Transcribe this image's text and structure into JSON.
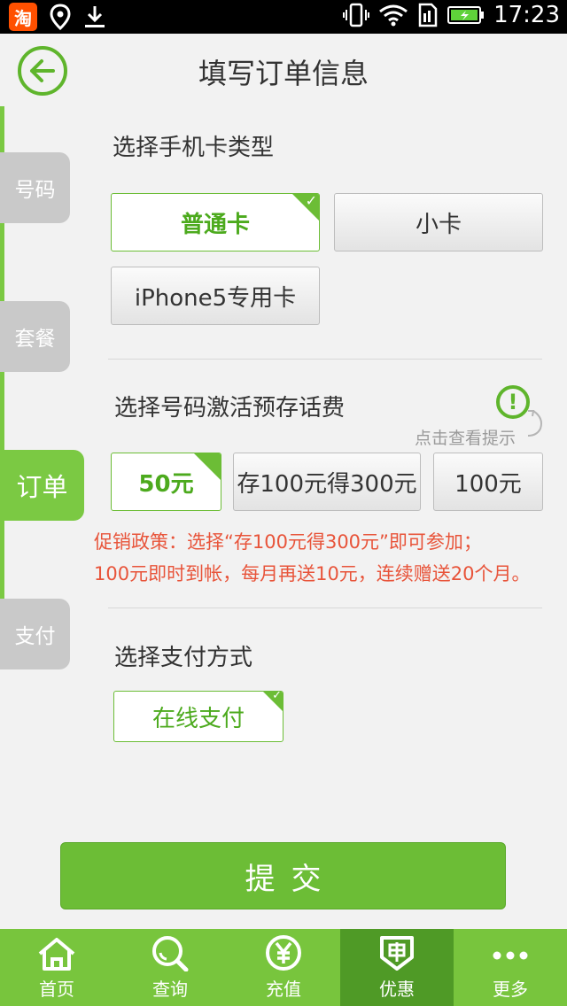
{
  "status_bar": {
    "app_badge": "淘",
    "time": "17:23"
  },
  "header": {
    "title": "填写订单信息"
  },
  "side_tabs": [
    {
      "label": "号码"
    },
    {
      "label": "套餐"
    },
    {
      "label": "订单",
      "active": true
    },
    {
      "label": "支付"
    }
  ],
  "card_type": {
    "title": "选择手机卡类型",
    "options": [
      {
        "label": "普通卡",
        "selected": true
      },
      {
        "label": "小卡"
      },
      {
        "label": "iPhone5专用卡"
      }
    ]
  },
  "prepaid": {
    "title": "选择号码激活预存话费",
    "hint": "点击查看提示",
    "options": [
      {
        "label": "50元",
        "selected": true
      },
      {
        "label": "存100元得300元"
      },
      {
        "label": "100元"
      }
    ],
    "promo_line1": "促销政策：选择“存100元得300元”即可参加；",
    "promo_line2": "100元即时到帐，每月再送10元，连续赠送20个月。"
  },
  "payment": {
    "title": "选择支付方式",
    "options": [
      {
        "label": "在线支付",
        "selected": true
      }
    ]
  },
  "submit_label": "提交",
  "bottom_nav": [
    {
      "label": "首页",
      "icon": "home-icon"
    },
    {
      "label": "查询",
      "icon": "search-icon"
    },
    {
      "label": "充值",
      "icon": "yuan-icon"
    },
    {
      "label": "优惠",
      "icon": "discount-icon",
      "active": true
    },
    {
      "label": "更多",
      "icon": "more-icon"
    }
  ],
  "colors": {
    "accent": "#6cbd36",
    "nav_bg": "#78c53d",
    "nav_active": "#4f9a26",
    "promo": "#e8543a"
  }
}
